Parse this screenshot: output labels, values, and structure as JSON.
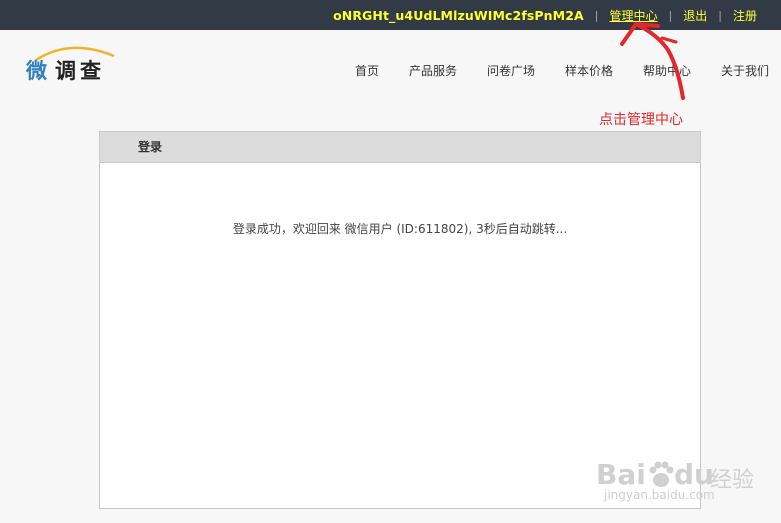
{
  "topbar": {
    "username": "oNRGHt_u4UdLMlzuWIMc2fsPnM2A",
    "manage_label": "管理中心",
    "logout_label": "退出",
    "register_label": "注册"
  },
  "logo": {
    "char1": "微",
    "rest": "调查"
  },
  "nav": {
    "items": [
      "首页",
      "产品服务",
      "问卷广场",
      "样本价格",
      "帮助中心",
      "关于我们"
    ]
  },
  "annotation": {
    "text": "点击管理中心",
    "color": "#e5262a"
  },
  "panel": {
    "title": "登录",
    "message": "登录成功，欢迎回来 微信用户 (ID:611802), 3秒后自动跳转..."
  },
  "watermark": {
    "brand_a": "Bai",
    "brand_b": "du",
    "brand_cn": "经验",
    "url": "jingyan.baidu.com"
  },
  "colors": {
    "topbar_bg": "#323a45",
    "topbar_text": "#ffff33",
    "logo_blue": "#2f7fc1"
  }
}
